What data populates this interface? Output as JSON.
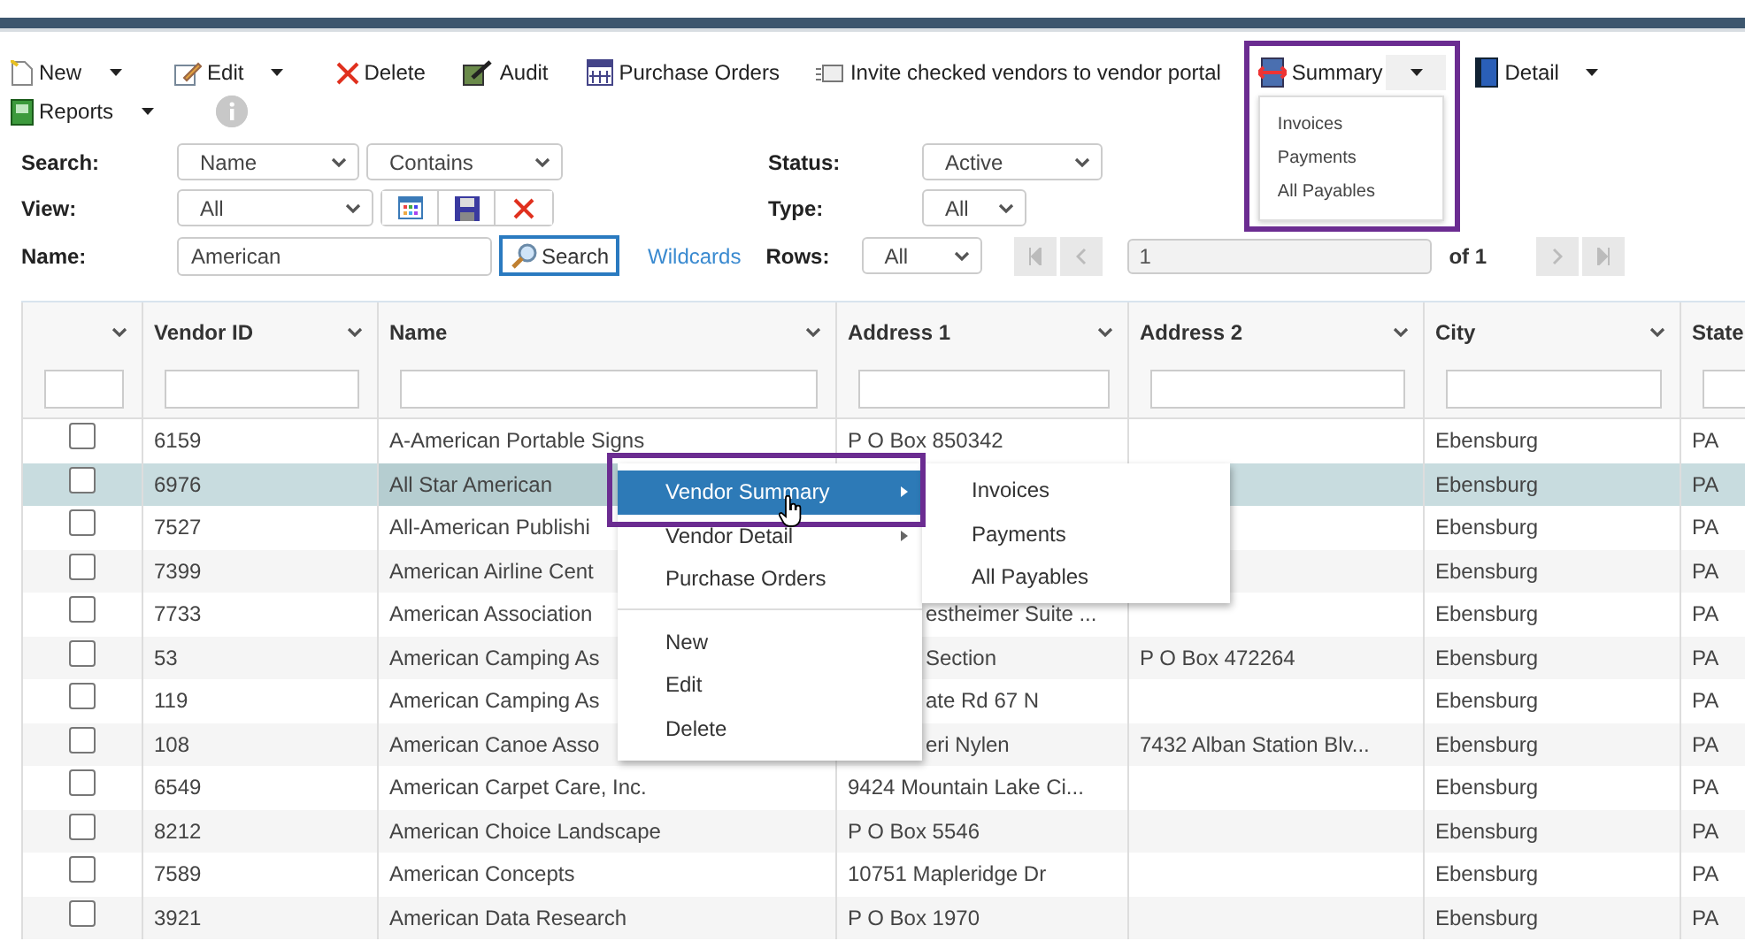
{
  "toolbar": {
    "row_1": [
      {
        "label": "New",
        "has_menu": true
      },
      {
        "label": "Edit",
        "has_menu": true
      },
      {
        "label": "Delete",
        "has_menu": false
      },
      {
        "label": "Audit",
        "has_menu": false
      },
      {
        "label": "Purchase Orders",
        "has_menu": false
      },
      {
        "label": "Invite checked vendors to vendor portal",
        "has_menu": false
      },
      {
        "label": "Summary",
        "has_menu": true,
        "expanded": true
      },
      {
        "label": "Detail",
        "has_menu": true,
        "expanded": false
      }
    ],
    "row_2": [
      {
        "label": "Reports",
        "has_menu": true
      }
    ]
  },
  "summary_menu": {
    "items": [
      "Invoices",
      "Payments",
      "All Payables"
    ]
  },
  "filters": {
    "search_label": "Search:",
    "search_field": "Name",
    "search_operator": "Contains",
    "status_label": "Status:",
    "status": "Active",
    "view_label": "View:",
    "view": "All",
    "type_label": "Type:",
    "type": "All",
    "name_label": "Name:",
    "name": "American",
    "search_button": "Search",
    "wildcards_link": "Wildcards",
    "rows_label": "Rows:",
    "rows": "All",
    "page": "1",
    "page_count": "of 1"
  },
  "table": {
    "columns": [
      "Vendor ID",
      "Name",
      "Address 1",
      "Address 2",
      "City",
      "State"
    ],
    "rows": [
      {
        "selected": false,
        "checked": false,
        "vendor_id": "6159",
        "name": "A-American Portable Signs",
        "address_1": "P O Box 850342",
        "city": "Ebensburg",
        "state": "PA"
      },
      {
        "selected": true,
        "checked": false,
        "vendor_id": "6976",
        "name": "All Star American",
        "city": "Ebensburg",
        "state": "PA"
      },
      {
        "selected": false,
        "checked": false,
        "vendor_id": "7527",
        "name": "All-American Publishi",
        "city": "Ebensburg",
        "state": "PA"
      },
      {
        "selected": false,
        "checked": false,
        "vendor_id": "7399",
        "name": "American Airline Cent",
        "city": "Ebensburg",
        "state": "PA"
      },
      {
        "selected": false,
        "checked": false,
        "vendor_id": "7733",
        "name": "American Association",
        "address_1": "estheimer Suite ...",
        "city": "Ebensburg",
        "state": "PA"
      },
      {
        "selected": false,
        "checked": false,
        "vendor_id": "53",
        "name": "American Camping As",
        "address_1": "Section",
        "address_2": "P O Box 472264",
        "city": "Ebensburg",
        "state": "PA"
      },
      {
        "selected": false,
        "checked": false,
        "vendor_id": "119",
        "name": "American Camping As",
        "address_1": "ate Rd 67 N",
        "city": "Ebensburg",
        "state": "PA"
      },
      {
        "selected": false,
        "checked": false,
        "vendor_id": "108",
        "name": "American Canoe Asso",
        "address_1": "eri Nylen",
        "address_2": "7432 Alban Station Blv...",
        "city": "Ebensburg",
        "state": "PA"
      },
      {
        "selected": false,
        "checked": false,
        "vendor_id": "6549",
        "name": "American Carpet Care, Inc.",
        "address_1": "9424 Mountain Lake Ci...",
        "city": "Ebensburg",
        "state": "PA"
      },
      {
        "selected": false,
        "checked": false,
        "vendor_id": "8212",
        "name": "American Choice Landscape",
        "address_1": "P O Box 5546",
        "city": "Ebensburg",
        "state": "PA"
      },
      {
        "selected": false,
        "checked": false,
        "vendor_id": "7589",
        "name": "American Concepts",
        "address_1": "10751 Mapleridge Dr",
        "city": "Ebensburg",
        "state": "PA"
      },
      {
        "selected": false,
        "checked": false,
        "vendor_id": "3921",
        "name": "American Data Research",
        "address_1": "P O Box 1970",
        "city": "Ebensburg",
        "state": "PA"
      }
    ]
  },
  "context_menu": {
    "items": [
      {
        "label": "Vendor Summary",
        "has_submenu": true,
        "selected": true,
        "separator_before": false
      },
      {
        "label": "Vendor Detail",
        "has_submenu": true,
        "selected": false,
        "separator_before": false
      },
      {
        "label": "Purchase Orders",
        "has_submenu": false,
        "selected": false,
        "separator_before": false
      },
      {
        "label": "New",
        "has_submenu": false,
        "selected": false,
        "separator_before": true
      },
      {
        "label": "Edit",
        "has_submenu": false,
        "selected": false,
        "separator_before": false
      },
      {
        "label": "Delete",
        "has_submenu": false,
        "selected": false,
        "separator_before": false
      }
    ],
    "submenu": [
      "Invoices",
      "Payments",
      "All Payables"
    ]
  }
}
